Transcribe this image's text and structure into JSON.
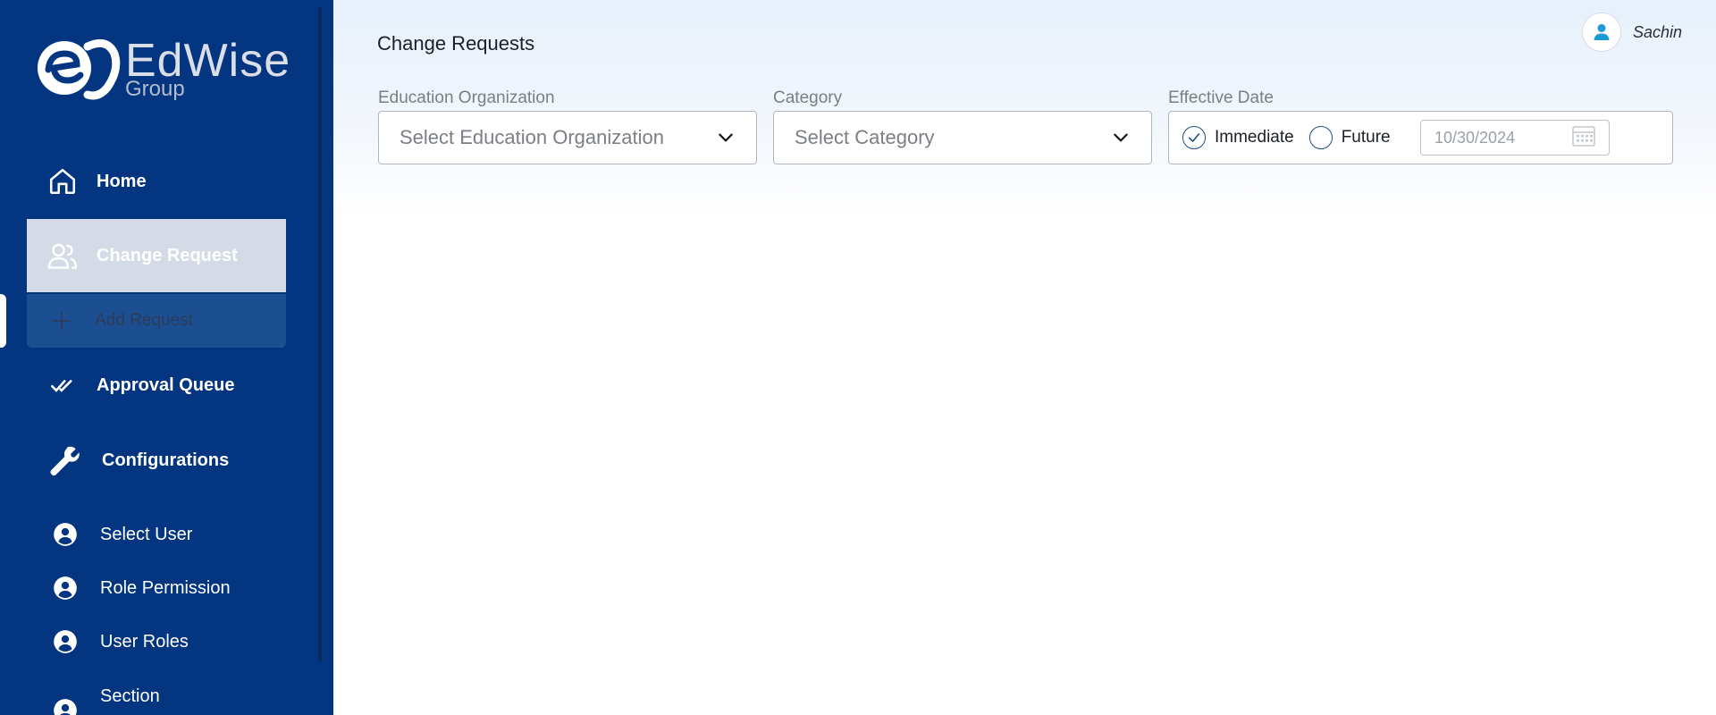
{
  "brand": {
    "word": "EdWise",
    "sub": "Group"
  },
  "sidebar": {
    "items": [
      {
        "label": "Home",
        "icon": "home-icon"
      },
      {
        "label": "Change Request",
        "icon": "users-icon"
      },
      {
        "label": "Add Request",
        "icon": "plus-icon"
      },
      {
        "label": "Approval Queue",
        "icon": "double-check-icon"
      },
      {
        "label": "Configurations",
        "icon": "wrench-icon"
      }
    ],
    "sub_items": [
      {
        "label": "Select User",
        "icon": "user-circle-icon"
      },
      {
        "label": "Role Permission",
        "icon": "user-circle-icon"
      },
      {
        "label": "User Roles",
        "icon": "user-circle-icon"
      },
      {
        "label": "Section",
        "icon": "user-circle-icon"
      }
    ]
  },
  "header": {
    "title": "Change Requests",
    "user_name": "Sachin"
  },
  "filters": {
    "education_org": {
      "label": "Education Organization",
      "placeholder": "Select Education Organization"
    },
    "category": {
      "label": "Category",
      "placeholder": "Select Category"
    },
    "effective_date": {
      "label": "Effective Date",
      "options": [
        "Immediate",
        "Future"
      ],
      "selected": "Immediate",
      "date_value": "10/30/2024"
    }
  },
  "colors": {
    "sidebar": "#033580",
    "active_item": "#d4dbe6",
    "accent": "#1f4d80",
    "avatar_icon": "#1a9ad6"
  }
}
